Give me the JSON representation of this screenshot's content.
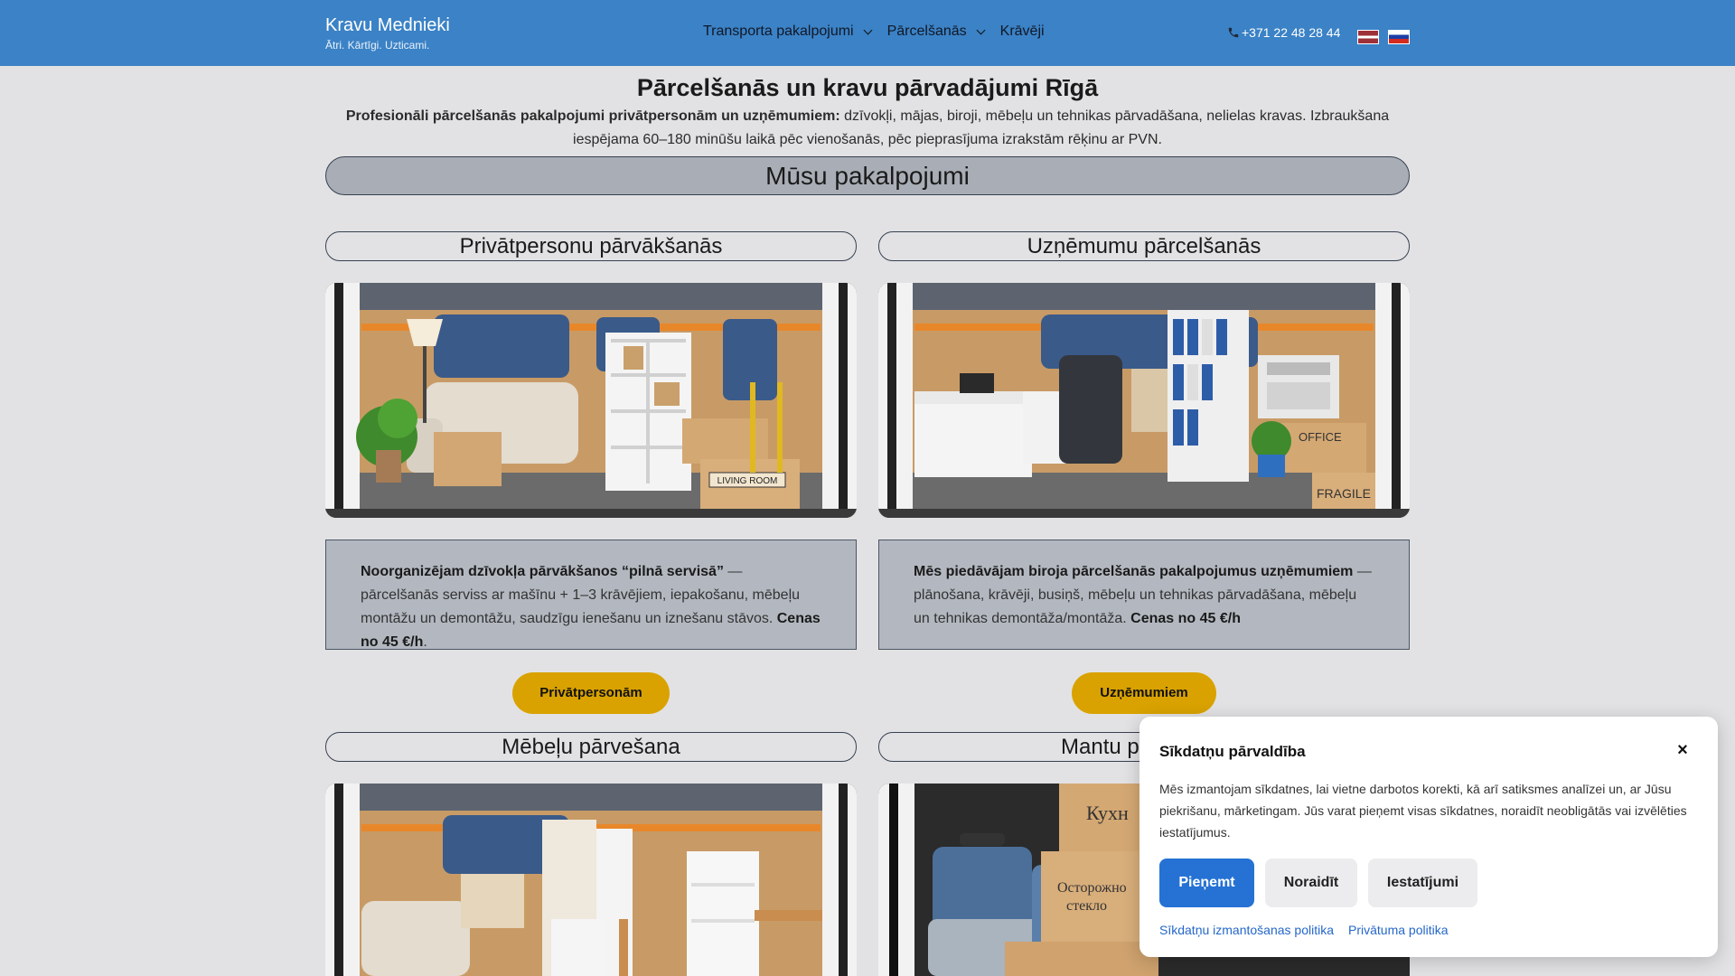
{
  "header": {
    "brand_name": "Kravu Mednieki",
    "brand_tagline": "Ātri. Kārtīgi. Uzticami.",
    "nav": [
      {
        "label": "Transporta pakalpojumi",
        "has_dropdown": true
      },
      {
        "label": "Pārcelšanās",
        "has_dropdown": true
      },
      {
        "label": "Krāvēji",
        "has_dropdown": false
      }
    ],
    "phone": "+371 22 48 28 44",
    "languages": [
      "lv",
      "ru"
    ]
  },
  "hero": {
    "title": "Pārcelšanās un kravu pārvadājumi Rīgā",
    "desc_bold": "Profesionāli pārcelšanās pakalpojumi privātpersonām un uzņēmumiem:",
    "desc_rest": " dzīvokļi, mājas, biroji, mēbeļu un tehnikas pārvadāšana, nelielas kravas. Izbraukšana iespējama 60–180 minūšu laikā pēc vienošanās, pēc pieprasījuma izrakstām rēķinu ar PVN."
  },
  "services": {
    "heading": "Mūsu pakalpojumi",
    "cards": [
      {
        "title": "Privātpersonu pārvākšanās",
        "desc_bold": "Noorganizējam dzīvokļa pārvākšanos “pilnā servisā”",
        "desc_rest": " — pārcelšanās serviss ar mašīnu + 1–3 krāvējiem, iepakošanu, mēbeļu montāžu un demontāžu, saudzīgu ienešanu un iznešanu stāvos. ",
        "price": "Cenas no 45 €/h",
        "button": "Privātpersonām"
      },
      {
        "title": "Uzņēmumu pārcelšanās",
        "desc_bold": "Mēs piedāvājam biroja pārcelšanās pakalpojumus uzņēmumiem",
        "desc_rest": " — plānošana, krāvēji, busiņš, mēbeļu un tehnikas pārvadāšana, mēbeļu un tehnikas demontāža/montāža. ",
        "price": "Cenas no 45 €/h",
        "button": "Uzņēmumiem"
      },
      {
        "title": "Mēbeļu pārvešana"
      },
      {
        "title": "Mantu p"
      }
    ]
  },
  "cookie": {
    "title": "Sīkdatņu pārvaldība",
    "close": "×",
    "text": "Mēs izmantojam sīkdatnes, lai vietne darbotos korekti, kā arī satiksmes analīzei un, ar Jūsu piekrišanu, mārketingam. Jūs varat pieņemt visas sīkdatnes, noraidīt neobligātās vai izvēlēties iestatījumus.",
    "accept": "Pieņemt",
    "decline": "Noraidīt",
    "settings": "Iestatījumi",
    "link_cookies": "Sīkdatņu izmantošanas politika",
    "link_privacy": "Privātuma politika"
  },
  "photo_text": {
    "living_room": "LIVING ROOM",
    "office": "OFFICE",
    "fragile": "FRAGILE",
    "kuhnya": "Кухн",
    "ostorozhno": "Осторожно",
    "steklo": "стекло"
  },
  "colors": {
    "header_bg": "#3b82c6",
    "page_bg": "#e2e2e4",
    "cta": "#d9a200",
    "accept": "#2572d4"
  }
}
